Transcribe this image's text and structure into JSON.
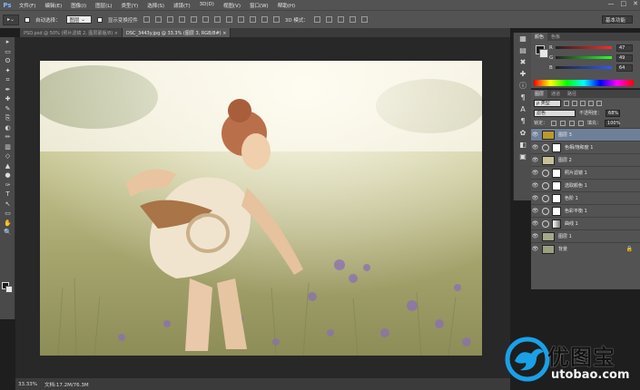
{
  "app": {
    "logo": "Ps",
    "menu": [
      "文件(F)",
      "编辑(E)",
      "图像(I)",
      "图层(L)",
      "类型(Y)",
      "选择(S)",
      "滤镜(T)",
      "3D(D)",
      "视图(V)",
      "窗口(W)",
      "帮助(H)"
    ],
    "window_controls": [
      "—",
      "□",
      "✕"
    ]
  },
  "options": {
    "auto_select_label": "自动选择：",
    "auto_select_value": "图层",
    "show_transform_label": "显示变换控件",
    "mode3d_label": "3D 模式：",
    "workspace": "基本功能"
  },
  "tabs": [
    {
      "label": "PSD.psd @ 50% (照片滤镜 2, 图层蒙版/8) ×",
      "active": false
    },
    {
      "label": "DSC_3443y.jpg @ 33.3% (图层 3, RGB/8#) ×",
      "active": true
    }
  ],
  "tools": [
    "▸",
    "▭",
    "ʘ",
    "✦",
    "⌗",
    "✒",
    "✚",
    "✎",
    "⎘",
    "◐",
    "✏",
    "▥",
    "◇",
    "▲",
    "●",
    "✑",
    "T",
    "↖",
    "▭",
    "✋",
    "🔍"
  ],
  "status": {
    "zoom": "33.33%",
    "doc": "文档:17.2M/76.3M"
  },
  "icon_strip": [
    "▦",
    "▤",
    "✖",
    "✚",
    "ⓘ",
    "¶",
    "A",
    "¶",
    "✿",
    "◧",
    "▣"
  ],
  "color_panel": {
    "tabs": [
      "颜色",
      "色板"
    ],
    "channels": [
      {
        "label": "R",
        "value": "47",
        "gradient": "#ff2a2a"
      },
      {
        "label": "G",
        "value": "49",
        "gradient": "#2aff2a"
      },
      {
        "label": "B",
        "value": "64",
        "gradient": "#2a5aff"
      }
    ]
  },
  "layers_panel": {
    "tabs": [
      "图层",
      "通道",
      "路径"
    ],
    "kind": "ρ 类型",
    "blend": "滤色",
    "opacity_label": "不透明度：",
    "opacity_value": "68%",
    "lock_label": "锁定：",
    "fill_label": "填充：",
    "fill_value": "100%",
    "layers": [
      {
        "name": "图层 3",
        "type": "pixel",
        "selected": true,
        "thumb_color": "#b89a2c"
      },
      {
        "name": "色相/饱和度 1",
        "type": "adjust",
        "selected": false
      },
      {
        "name": "图层 2",
        "type": "pixel",
        "selected": false,
        "thumb_color": "#c8c09a"
      },
      {
        "name": "照片滤镜 1",
        "type": "adjust",
        "selected": false
      },
      {
        "name": "选取颜色 1",
        "type": "adjust",
        "selected": false
      },
      {
        "name": "色阶 1",
        "type": "adjust",
        "selected": false
      },
      {
        "name": "色彩平衡 1",
        "type": "adjust",
        "selected": false
      },
      {
        "name": "曲线 1",
        "type": "adjust-mask",
        "selected": false
      },
      {
        "name": "图层 1",
        "type": "pixel",
        "selected": false,
        "thumb_color": "#a4a88a"
      },
      {
        "name": "背景",
        "type": "pixel",
        "selected": false,
        "thumb_color": "#9aa080",
        "locked": true
      }
    ]
  },
  "watermark": {
    "title": "优图宝",
    "url": "utobao.com",
    "accent": "#1aa0e8"
  }
}
